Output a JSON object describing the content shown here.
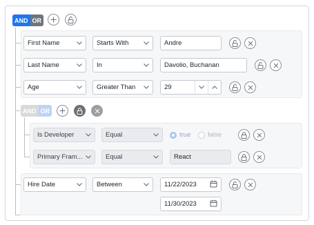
{
  "root": {
    "and_label": "AND",
    "or_label": "OR"
  },
  "rules": {
    "r1": {
      "field": "First Name",
      "operator": "Starts With",
      "value": "Andre"
    },
    "r2": {
      "field": "Last Name",
      "operator": "In",
      "value": "Davolio, Buchanan"
    },
    "r3": {
      "field": "Age",
      "operator": "Greater Than",
      "value": "29"
    }
  },
  "subgroup": {
    "and_label": "AND",
    "or_label": "OR",
    "r1": {
      "field": "Is Developer",
      "operator": "Equal",
      "opt_true": "true",
      "opt_false": "false"
    },
    "r2": {
      "field": "Primary Fram...",
      "operator": "Equal",
      "value": "React"
    }
  },
  "last_rule": {
    "field": "Hire Date",
    "operator": "Between",
    "from": "11/22/2023",
    "to": "11/30/2023"
  },
  "colors": {
    "accent": "#1f75f0",
    "or_bg": "#6e7580"
  }
}
